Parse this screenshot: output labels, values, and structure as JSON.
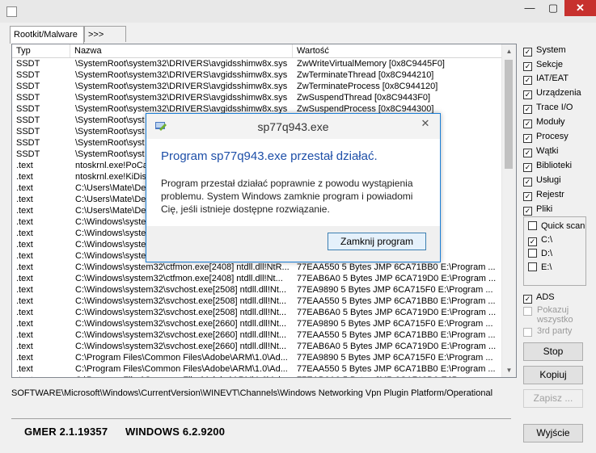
{
  "window": {
    "min_label": "—",
    "max_label": "▢",
    "close_label": "✕"
  },
  "tabs": [
    {
      "label": "Rootkit/Malware"
    },
    {
      "label": ">>>"
    }
  ],
  "table": {
    "columns": [
      "Typ",
      "Nazwa",
      "Wartość"
    ],
    "rows": [
      [
        "SSDT",
        "\\SystemRoot\\system32\\DRIVERS\\avgidsshimw8x.sys",
        "ZwWriteVirtualMemory [0x8C9445F0]"
      ],
      [
        "SSDT",
        "\\SystemRoot\\system32\\DRIVERS\\avgidsshimw8x.sys",
        "ZwTerminateThread [0x8C944210]"
      ],
      [
        "SSDT",
        "\\SystemRoot\\system32\\DRIVERS\\avgidsshimw8x.sys",
        "ZwTerminateProcess [0x8C944120]"
      ],
      [
        "SSDT",
        "\\SystemRoot\\system32\\DRIVERS\\avgidsshimw8x.sys",
        "ZwSuspendThread [0x8C9443F0]"
      ],
      [
        "SSDT",
        "\\SystemRoot\\system32\\DRIVERS\\avgidsshimw8x.sys",
        "ZwSuspendProcess [0x8C944300]"
      ],
      [
        "SSDT",
        "\\SystemRoot\\syst",
        ""
      ],
      [
        "SSDT",
        "\\SystemRoot\\syst",
        ""
      ],
      [
        "SSDT",
        "\\SystemRoot\\syst",
        "4820]"
      ],
      [
        "SSDT",
        "\\SystemRoot\\syst",
        ""
      ],
      [
        ".text",
        "ntoskrnl.exe!PoCa",
        ""
      ],
      [
        ".text",
        "ntoskrnl.exe!KiDisp",
        "07, 73, 09, ..."
      ],
      [
        ".text",
        "C:\\Users\\Mate\\De",
        "E:\\Program ..."
      ],
      [
        ".text",
        "C:\\Users\\Mate\\De",
        "E:\\Program ..."
      ],
      [
        ".text",
        "C:\\Users\\Mate\\De",
        "E:\\Program ..."
      ],
      [
        ".text",
        "C:\\Windows\\syste",
        "E:\\Program ..."
      ],
      [
        ".text",
        "C:\\Windows\\syste",
        "E:\\Program ..."
      ],
      [
        ".text",
        "C:\\Windows\\syste",
        "E:\\Program ..."
      ],
      [
        ".text",
        "C:\\Windows\\syste",
        "E:\\Program ..."
      ],
      [
        ".text",
        "C:\\Windows\\system32\\ctfmon.exe[2408] ntdll.dll!NtR...",
        "77EAA550 5 Bytes  JMP 6CA71BB0 E:\\Program ..."
      ],
      [
        ".text",
        "C:\\Windows\\system32\\ctfmon.exe[2408] ntdll.dll!Nt...",
        "77EAB6A0 5 Bytes  JMP 6CA719D0 E:\\Program ..."
      ],
      [
        ".text",
        "C:\\Windows\\system32\\svchost.exe[2508] ntdll.dll!Nt...",
        "77EA9890 5 Bytes  JMP 6CA715F0 E:\\Program ..."
      ],
      [
        ".text",
        "C:\\Windows\\system32\\svchost.exe[2508] ntdll.dll!Nt...",
        "77EAA550 5 Bytes  JMP 6CA71BB0 E:\\Program ..."
      ],
      [
        ".text",
        "C:\\Windows\\system32\\svchost.exe[2508] ntdll.dll!Nt...",
        "77EAB6A0 5 Bytes  JMP 6CA719D0 E:\\Program ..."
      ],
      [
        ".text",
        "C:\\Windows\\system32\\svchost.exe[2660] ntdll.dll!Nt...",
        "77EA9890 5 Bytes  JMP 6CA715F0 E:\\Program ..."
      ],
      [
        ".text",
        "C:\\Windows\\system32\\svchost.exe[2660] ntdll.dll!Nt...",
        "77EAA550 5 Bytes  JMP 6CA71BB0 E:\\Program ..."
      ],
      [
        ".text",
        "C:\\Windows\\system32\\svchost.exe[2660] ntdll.dll!Nt...",
        "77EAB6A0 5 Bytes  JMP 6CA719D0 E:\\Program ..."
      ],
      [
        ".text",
        "C:\\Program Files\\Common Files\\Adobe\\ARM\\1.0\\Ad...",
        "77EA9890 5 Bytes  JMP 6CA715F0 E:\\Program ..."
      ],
      [
        ".text",
        "C:\\Program Files\\Common Files\\Adobe\\ARM\\1.0\\Ad...",
        "77EAA550 5 Bytes  JMP 6CA71BB0 E:\\Program ..."
      ],
      [
        ".text",
        "C:\\Program Files\\Common Files\\Adobe\\ARM\\1.0\\Ad...",
        "77EAB6A0 5 Bytes  JMP 6CA719D0 E:\\Program ..."
      ]
    ]
  },
  "path_line": "SOFTWARE\\Microsoft\\Windows\\CurrentVersion\\WINEVT\\Channels\\Windows Networking Vpn Plugin Platform/Operational",
  "options": {
    "system": "System",
    "sekcje": "Sekcje",
    "iat_eat": "IAT/EAT",
    "urzadzenia": "Urządzenia",
    "trace_io": "Trace I/O",
    "moduly": "Moduły",
    "procesy": "Procesy",
    "watki": "Wątki",
    "biblioteki": "Biblioteki",
    "uslugi": "Usługi",
    "rejestr": "Rejestr",
    "pliki": "Pliki",
    "quick_scan": "Quick scan",
    "drive_c": "C:\\",
    "drive_d": "D:\\",
    "drive_e": "E:\\",
    "ads": "ADS",
    "pokazuj_wszystko": "Pokazuj wszystko",
    "third_party": "3rd party"
  },
  "check_mark": "✓",
  "buttons": {
    "stop": "Stop",
    "kopiuj": "Kopiuj",
    "zapisz": "Zapisz ...",
    "wyjscie": "Wyjście"
  },
  "status": {
    "version": "GMER 2.1.19357",
    "os": "WINDOWS 6.2.9200"
  },
  "dialog": {
    "title": "sp77q943.exe",
    "heading": "Program sp77q943.exe przestał działać.",
    "body": "Program przestał działać poprawnie z powodu wystąpienia problemu. System Windows zamknie program i powiadomi Cię, jeśli istnieje dostępne rozwiązanie.",
    "close_button": "Zamknij program",
    "close_icon": "✕"
  }
}
